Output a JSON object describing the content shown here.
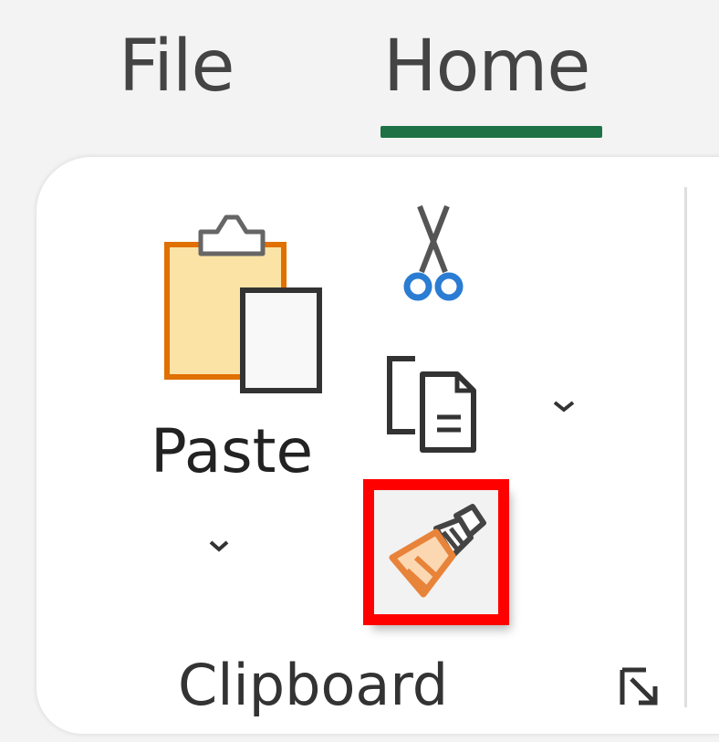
{
  "tabs": {
    "file": "File",
    "home": "Home",
    "active": "Home"
  },
  "clipboard_group": {
    "label": "Clipboard",
    "paste_label": "Paste",
    "commands": [
      "paste",
      "cut",
      "copy",
      "format-painter"
    ],
    "highlighted_command": "format-painter",
    "dialog_launcher_icon": "dialog-launcher-icon"
  },
  "colors": {
    "active_tab_underline": "#1e7145",
    "highlight_border": "#ff0000",
    "clipboard_orange": "#e07000",
    "scissors_blue": "#2b7cd3",
    "brush_orange": "#e8833a"
  },
  "icons": {
    "paste": "clipboard-paste-icon",
    "cut": "scissors-icon",
    "copy": "copy-icon",
    "format_painter": "paintbrush-icon"
  }
}
